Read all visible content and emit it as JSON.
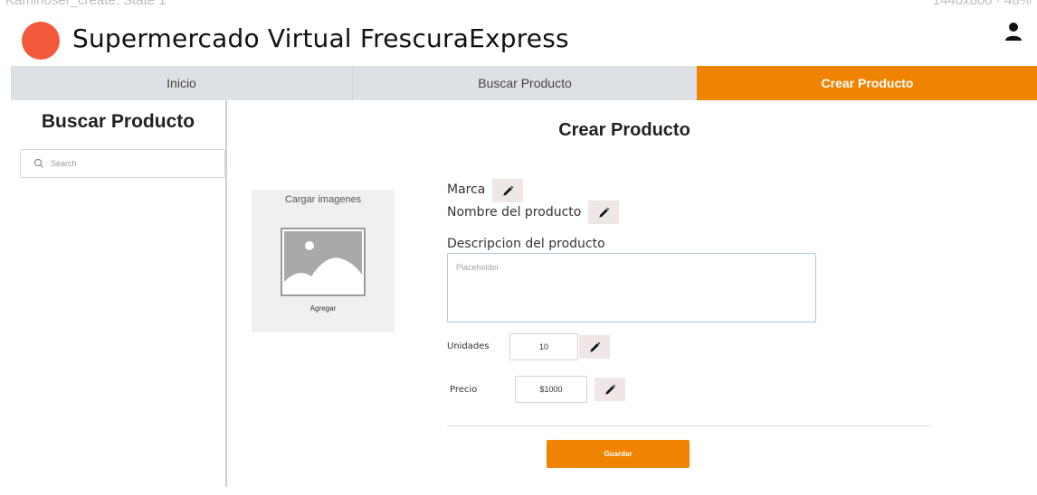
{
  "window": {
    "cut_label_left": "Kaminoser_create: State 1",
    "cut_label_right": "1440x800 · 48%"
  },
  "header": {
    "title": "Supermercado Virtual FrescuraExpress",
    "logo_color": "#f25a3c",
    "user_icon": "user-icon"
  },
  "nav": {
    "tabs": [
      {
        "label": "Inicio",
        "active": false
      },
      {
        "label": "Buscar Producto",
        "active": false
      },
      {
        "label": "Crear Producto",
        "active": true
      }
    ],
    "active_color": "#f08300"
  },
  "sidebar": {
    "title": "Buscar Producto",
    "search_placeholder": "Search",
    "search_icon": "search-icon"
  },
  "main": {
    "title": "Crear Producto",
    "upload": {
      "label": "Cargar imagenes",
      "add_label": "Agregar",
      "icon": "image-placeholder-icon"
    },
    "form": {
      "marca_label": "Marca",
      "nombre_label": "Nombre del producto",
      "descripcion_label": "Descripcion del producto",
      "descripcion_placeholder": "Placeholder",
      "unidades_label": "Unidades",
      "unidades_value": "10",
      "precio_label": "Precio",
      "precio_value": "$1000",
      "edit_icon": "pencil-icon"
    },
    "save_label": "Guardar"
  }
}
